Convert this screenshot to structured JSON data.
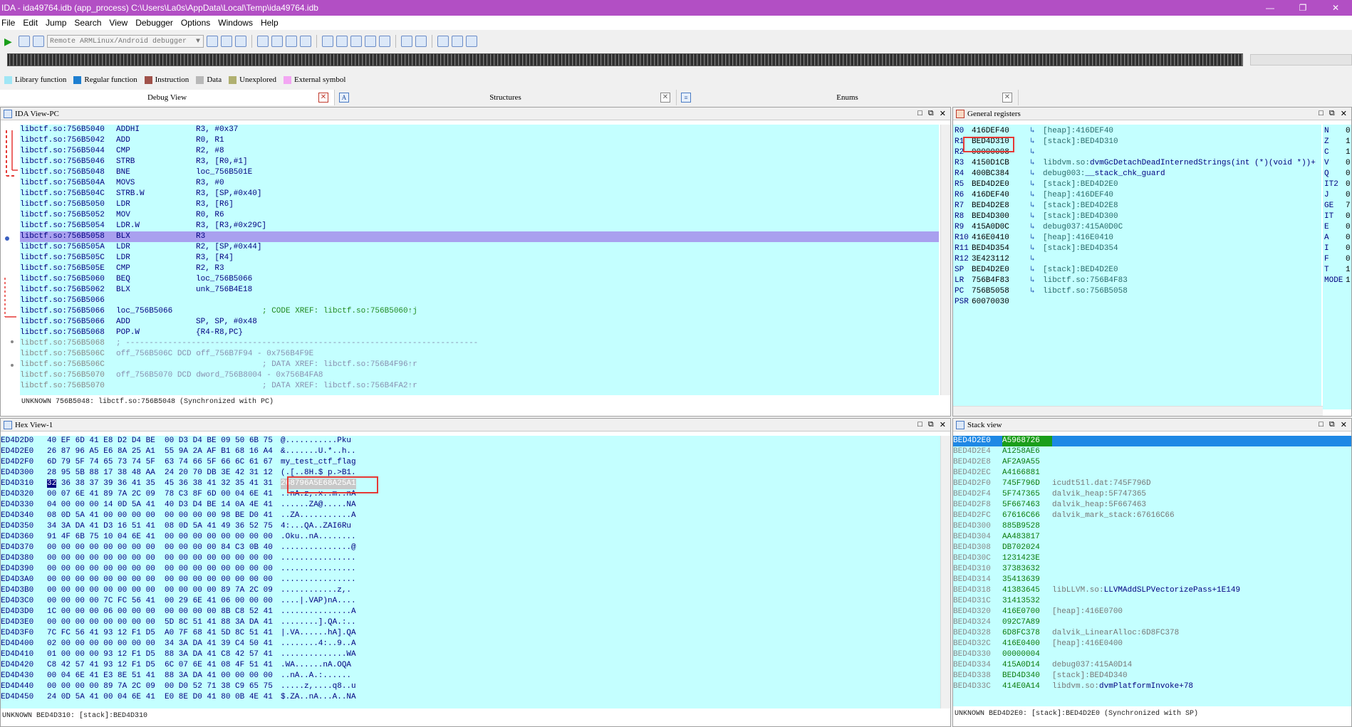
{
  "window": {
    "title": "IDA - ida49764.idb (app_process) C:\\Users\\La0s\\AppData\\Local\\Temp\\ida49764.idb",
    "controls": [
      "—",
      "❐",
      "✕"
    ]
  },
  "menu": [
    "File",
    "Edit",
    "Jump",
    "Search",
    "View",
    "Debugger",
    "Options",
    "Windows",
    "Help"
  ],
  "toolbar": {
    "debugger_select": "Remote ARMLinux/Android debugger",
    "select_arrow": "▼"
  },
  "legend": [
    {
      "label": "Library function",
      "color": "#a0e6f5"
    },
    {
      "label": "Regular function",
      "color": "#1e7fd0"
    },
    {
      "label": "Instruction",
      "color": "#a0524a"
    },
    {
      "label": "Data",
      "color": "#b8b8b8"
    },
    {
      "label": "Unexplored",
      "color": "#b0b070"
    },
    {
      "label": "External symbol",
      "color": "#f3a6f3"
    }
  ],
  "tabs": [
    {
      "label": "Debug View",
      "close": "✕"
    },
    {
      "label": "Structures",
      "close": "✕",
      "icon": "A"
    },
    {
      "label": "Enums",
      "close": "✕",
      "icon": "≡"
    }
  ],
  "panel_buttons": [
    "□",
    "⧉",
    "✕"
  ],
  "ida_view": {
    "title": "IDA View-PC",
    "status": "UNKNOWN 756B5048: libctf.so:756B5048 (Synchronized with PC)",
    "lines": [
      {
        "addr": "libctf.so:756B5040",
        "mn": "ADDHI",
        "op": "R3, #0x37"
      },
      {
        "addr": "libctf.so:756B5042",
        "mn": "ADD",
        "op": "R0, R1"
      },
      {
        "addr": "libctf.so:756B5044",
        "mn": "CMP",
        "op": "R2, #8"
      },
      {
        "addr": "libctf.so:756B5046",
        "mn": "STRB",
        "op": "R3, [R0,#1]"
      },
      {
        "addr": "libctf.so:756B5048",
        "mn": "BNE",
        "op": "loc_756B501E"
      },
      {
        "addr": "libctf.so:756B504A",
        "mn": "MOVS",
        "op": "R3, #0"
      },
      {
        "addr": "libctf.so:756B504C",
        "mn": "STRB.W",
        "op": "R3, [SP,#0x40]"
      },
      {
        "addr": "libctf.so:756B5050",
        "mn": "LDR",
        "op": "R3, [R6]"
      },
      {
        "addr": "libctf.so:756B5052",
        "mn": "MOV",
        "op": "R0, R6"
      },
      {
        "addr": "libctf.so:756B5054",
        "mn": "LDR.W",
        "op": "R3, [R3,#0x29C]"
      },
      {
        "addr": "libctf.so:756B5058",
        "mn": "BLX",
        "op": "R3",
        "hl": true
      },
      {
        "addr": "libctf.so:756B505A",
        "mn": "LDR",
        "op": "R2, [SP,#0x44]"
      },
      {
        "addr": "libctf.so:756B505C",
        "mn": "LDR",
        "op": "R3, [R4]"
      },
      {
        "addr": "libctf.so:756B505E",
        "mn": "CMP",
        "op": "R2, R3"
      },
      {
        "addr": "libctf.so:756B5060",
        "mn": "BEQ",
        "op": "loc_756B5066"
      },
      {
        "addr": "libctf.so:756B5062",
        "mn": "BLX",
        "op": "unk_756B4E18"
      },
      {
        "addr": "libctf.so:756B5066",
        "mn": "",
        "op": ""
      },
      {
        "addr": "libctf.so:756B5066",
        "mn": "loc_756B5066",
        "op": "",
        "cmt": "; CODE XREF: libctf.so:756B5060↑j"
      },
      {
        "addr": "libctf.so:756B5066",
        "mn": "ADD",
        "op": "SP, SP, #0x48"
      },
      {
        "addr": "libctf.so:756B5068",
        "mn": "POP.W",
        "op": "{R4-R8,PC}"
      },
      {
        "addr": "libctf.so:756B5068",
        "mn": "; ---------------------------------------------------------------------------",
        "op": "",
        "grey": true
      },
      {
        "addr": "libctf.so:756B506C",
        "mn": "off_756B506C DCD off_756B7F94 - 0x756B4F9E",
        "op": "",
        "grey": true
      },
      {
        "addr": "libctf.so:756B506C",
        "mn": "",
        "op": "",
        "cmt": "; DATA XREF: libctf.so:756B4F96↑r",
        "grey": true
      },
      {
        "addr": "libctf.so:756B5070",
        "mn": "off_756B5070 DCD dword_756B8004 - 0x756B4FA8",
        "op": "",
        "grey": true
      },
      {
        "addr": "libctf.so:756B5070",
        "mn": "",
        "op": "",
        "cmt": "; DATA XREF: libctf.so:756B4FA2↑r",
        "grey": true
      }
    ]
  },
  "registers": {
    "title": "General registers",
    "rows": [
      {
        "name": "R0",
        "val": "416DEF40",
        "desc": "[heap]:416DEF40"
      },
      {
        "name": "R1",
        "val": "BED4D310",
        "desc": "[stack]:BED4D310"
      },
      {
        "name": "R2",
        "val": "00000008",
        "desc": ""
      },
      {
        "name": "R3",
        "val": "4150D1CB",
        "desc": "libdvm.so:",
        "sym": "dvmGcDetachDeadInternedStrings(int (*)(void *))+"
      },
      {
        "name": "R4",
        "val": "400BC384",
        "desc": "debug003:",
        "sym": "__stack_chk_guard"
      },
      {
        "name": "R5",
        "val": "BED4D2E0",
        "desc": "[stack]:BED4D2E0"
      },
      {
        "name": "R6",
        "val": "416DEF40",
        "desc": "[heap]:416DEF40"
      },
      {
        "name": "R7",
        "val": "BED4D2E8",
        "desc": "[stack]:BED4D2E8"
      },
      {
        "name": "R8",
        "val": "BED4D300",
        "desc": "[stack]:BED4D300"
      },
      {
        "name": "R9",
        "val": "415A0D0C",
        "desc": "debug037:415A0D0C"
      },
      {
        "name": "R10",
        "val": "416E0410",
        "desc": "[heap]:416E0410"
      },
      {
        "name": "R11",
        "val": "BED4D354",
        "desc": "[stack]:BED4D354"
      },
      {
        "name": "R12",
        "val": "3E423112",
        "desc": ""
      },
      {
        "name": "SP",
        "val": "BED4D2E0",
        "desc": "[stack]:BED4D2E0"
      },
      {
        "name": "LR",
        "val": "756B4F83",
        "desc": "libctf.so:756B4F83"
      },
      {
        "name": "PC",
        "val": "756B5058",
        "desc": "libctf.so:756B5058"
      },
      {
        "name": "PSR",
        "val": "60070030",
        "desc": "",
        "noarrow": true
      }
    ],
    "flags": [
      {
        "name": "N",
        "val": "0"
      },
      {
        "name": "Z",
        "val": "1"
      },
      {
        "name": "C",
        "val": "1"
      },
      {
        "name": "V",
        "val": "0"
      },
      {
        "name": "Q",
        "val": "0"
      },
      {
        "name": "IT2",
        "val": "0"
      },
      {
        "name": "J",
        "val": "0"
      },
      {
        "name": "GE",
        "val": "7"
      },
      {
        "name": "IT",
        "val": "0"
      },
      {
        "name": "E",
        "val": "0"
      },
      {
        "name": "A",
        "val": "0"
      },
      {
        "name": "I",
        "val": "0"
      },
      {
        "name": "F",
        "val": "0"
      },
      {
        "name": "T",
        "val": "1"
      },
      {
        "name": "MODE",
        "val": "1"
      }
    ]
  },
  "hex_view": {
    "title": "Hex View-1",
    "status": "UNKNOWN BED4D310: [stack]:BED4D310",
    "rows": [
      {
        "addr": "ED4D2D0",
        "b1": "40 EF 6D 41 E8 D2 D4 BE",
        "b2": "00 D3 D4 BE 09 50 6B 75",
        "asc": "@...........Pku"
      },
      {
        "addr": "ED4D2E0",
        "b1": "26 87 96 A5 E6 8A 25 A1",
        "b2": "55 9A 2A AF B1 68 16 A4",
        "asc": "&.......U.*..h.."
      },
      {
        "addr": "ED4D2F0",
        "b1": "6D 79 5F 74 65 73 74 5F",
        "b2": "63 74 66 5F 66 6C 61 67",
        "asc": "my_test_ctf_flag"
      },
      {
        "addr": "ED4D300",
        "b1": "28 95 5B 88 17 38 48 AA",
        "b2": "24 20 70 DB 3E 42 31 12",
        "asc": "(.[..8H.$ p.>B1."
      },
      {
        "addr": "ED4D310",
        "b1": "36 38 37 39 36 41 35",
        "b1sel": "32",
        "b2": "45 36 38 41 32 35 41 31",
        "asc": "268796A5E68A25A1",
        "sel": true
      },
      {
        "addr": "ED4D320",
        "b1": "00 07 6E 41 89 7A 2C 09",
        "b2": "78 C3 8F 6D 00 04 6E 41",
        "asc": "..nA.z,.x..m..nA"
      },
      {
        "addr": "ED4D330",
        "b1": "04 00 00 00 14 0D 5A 41",
        "b2": "40 D3 D4 BE 14 0A 4E 41",
        "asc": "......ZA@.....NA"
      },
      {
        "addr": "ED4D340",
        "b1": "08 0D 5A 41 00 00 00 00",
        "b2": "00 00 00 00 98 BE D0 41",
        "asc": "..ZA...........A"
      },
      {
        "addr": "ED4D350",
        "b1": "34 3A DA 41 D3 16 51 41",
        "b2": "08 0D 5A 41 49 36 52 75",
        "asc": "4:...QA..ZAI6Ru"
      },
      {
        "addr": "ED4D360",
        "b1": "91 4F 6B 75 10 04 6E 41",
        "b2": "00 00 00 00 00 00 00 00",
        "asc": ".Oku..nA........"
      },
      {
        "addr": "ED4D370",
        "b1": "00 00 00 00 00 00 00 00",
        "b2": "00 00 00 00 84 C3 0B 40",
        "asc": "...............@"
      },
      {
        "addr": "ED4D380",
        "b1": "00 00 00 00 00 00 00 00",
        "b2": "00 00 00 00 00 00 00 00",
        "asc": "................"
      },
      {
        "addr": "ED4D390",
        "b1": "00 00 00 00 00 00 00 00",
        "b2": "00 00 00 00 00 00 00 00",
        "asc": "................"
      },
      {
        "addr": "ED4D3A0",
        "b1": "00 00 00 00 00 00 00 00",
        "b2": "00 00 00 00 00 00 00 00",
        "asc": "................"
      },
      {
        "addr": "ED4D3B0",
        "b1": "00 00 00 00 00 00 00 00",
        "b2": "00 00 00 00 89 7A 2C 09",
        "asc": "............z,."
      },
      {
        "addr": "ED4D3C0",
        "b1": "00 00 00 00 7C FC 56 41",
        "b2": "00 29 6E 41 06 00 00 00",
        "asc": "....|.VAP)nA...."
      },
      {
        "addr": "ED4D3D0",
        "b1": "1C 00 00 00 06 00 00 00",
        "b2": "00 00 00 00 8B C8 52 41",
        "asc": "...............A"
      },
      {
        "addr": "ED4D3E0",
        "b1": "00 00 00 00 00 00 00 00",
        "b2": "5D 8C 51 41 88 3A DA 41",
        "asc": "........].QA.:.."
      },
      {
        "addr": "ED4D3F0",
        "b1": "7C FC 56 41 93 12 F1 D5",
        "b2": "A0 7F 68 41 5D 8C 51 41",
        "asc": "|.VA......hA].QA"
      },
      {
        "addr": "ED4D400",
        "b1": "02 00 00 00 00 00 00 00",
        "b2": "34 3A DA 41 39 C4 50 41",
        "asc": "........4:..9..A"
      },
      {
        "addr": "ED4D410",
        "b1": "01 00 00 00 93 12 F1 D5",
        "b2": "88 3A DA 41 C8 42 57 41",
        "asc": "..............WA"
      },
      {
        "addr": "ED4D420",
        "b1": "C8 42 57 41 93 12 F1 D5",
        "b2": "6C 07 6E 41 08 4F 51 41",
        "asc": ".WA......nA.OQA"
      },
      {
        "addr": "ED4D430",
        "b1": "00 04 6E 41 E3 8E 51 41",
        "b2": "88 3A DA 41 00 00 00 00",
        "asc": "..nA..A.:......"
      },
      {
        "addr": "ED4D440",
        "b1": "00 00 00 00 89 7A 2C 09",
        "b2": "00 D0 52 71 38 C9 65 75",
        "asc": ".....z,....q8..u"
      },
      {
        "addr": "ED4D450",
        "b1": "24 0D 5A 41 00 04 6E 41",
        "b2": "E0 8E D0 41 80 0B 4E 41",
        "asc": "$.ZA..nA...A..NA"
      }
    ]
  },
  "stack_view": {
    "title": "Stack view",
    "status": "UNKNOWN BED4D2E0: [stack]:BED4D2E0 (Synchronized with SP)",
    "rows": [
      {
        "addr": "BED4D2E0",
        "val": "A5968726",
        "desc": ""
      },
      {
        "addr": "BED4D2E4",
        "val": "A1258AE6",
        "desc": ""
      },
      {
        "addr": "BED4D2E8",
        "val": "AF2A9A55",
        "desc": ""
      },
      {
        "addr": "BED4D2EC",
        "val": "A4166881",
        "desc": ""
      },
      {
        "addr": "BED4D2F0",
        "val": "745F796D",
        "desc": "icudt51l.dat:745F796D"
      },
      {
        "addr": "BED4D2F4",
        "val": "5F747365",
        "desc": "dalvik_heap:5F747365"
      },
      {
        "addr": "BED4D2F8",
        "val": "5F667463",
        "desc": "dalvik_heap:5F667463"
      },
      {
        "addr": "BED4D2FC",
        "val": "67616C66",
        "desc": "dalvik_mark_stack:67616C66"
      },
      {
        "addr": "BED4D300",
        "val": "885B9528",
        "desc": ""
      },
      {
        "addr": "BED4D304",
        "val": "AA483817",
        "desc": ""
      },
      {
        "addr": "BED4D308",
        "val": "DB702024",
        "desc": ""
      },
      {
        "addr": "BED4D30C",
        "val": "1231423E",
        "desc": ""
      },
      {
        "addr": "BED4D310",
        "val": "37383632",
        "desc": ""
      },
      {
        "addr": "BED4D314",
        "val": "35413639",
        "desc": ""
      },
      {
        "addr": "BED4D318",
        "val": "41383645",
        "desc": "libLLVM.so:",
        "sym": "LLVMAddSLPVectorizePass+1E149"
      },
      {
        "addr": "BED4D31C",
        "val": "31413532",
        "desc": ""
      },
      {
        "addr": "BED4D320",
        "val": "416E0700",
        "desc": "[heap]:416E0700"
      },
      {
        "addr": "BED4D324",
        "val": "092C7A89",
        "desc": ""
      },
      {
        "addr": "BED4D328",
        "val": "6D8FC378",
        "desc": "dalvik_LinearAlloc:6D8FC378"
      },
      {
        "addr": "BED4D32C",
        "val": "416E0400",
        "desc": "[heap]:416E0400"
      },
      {
        "addr": "BED4D330",
        "val": "00000004",
        "desc": ""
      },
      {
        "addr": "BED4D334",
        "val": "415A0D14",
        "desc": "debug037:415A0D14"
      },
      {
        "addr": "BED4D338",
        "val": "BED4D340",
        "desc": "[stack]:BED4D340"
      },
      {
        "addr": "BED4D33C",
        "val": "414E0A14",
        "desc": "libdvm.so:",
        "sym": "dvmPlatformInvoke+78"
      }
    ]
  }
}
